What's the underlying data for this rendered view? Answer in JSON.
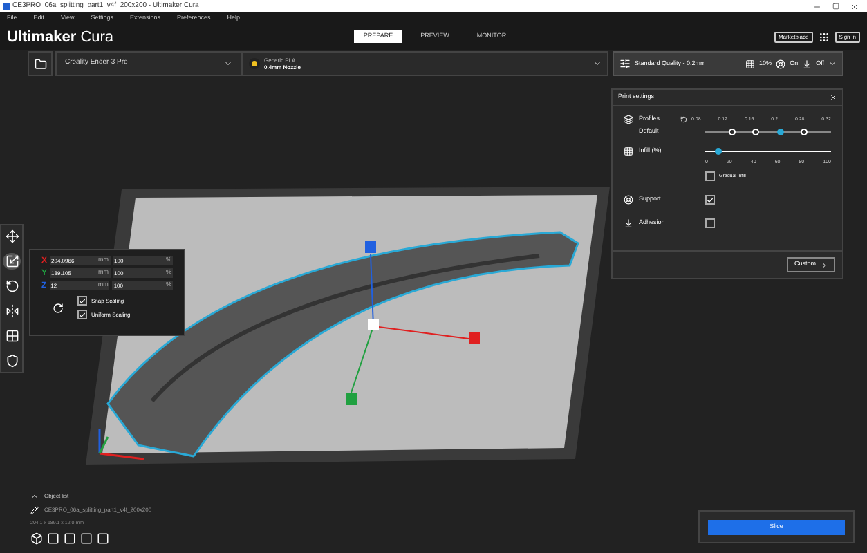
{
  "window": {
    "title": "CE3PRO_06a_splitting_part1_v4f_200x200 - Ultimaker Cura"
  },
  "menu": [
    "File",
    "Edit",
    "View",
    "Settings",
    "Extensions",
    "Preferences",
    "Help"
  ],
  "logo": {
    "brand": "Ultimaker",
    "product": "Cura"
  },
  "tabs": [
    {
      "label": "PREPARE",
      "selected": true
    },
    {
      "label": "PREVIEW",
      "selected": false
    },
    {
      "label": "MONITOR",
      "selected": false
    }
  ],
  "header_buttons": [
    "Marketplace",
    "Sign in"
  ],
  "printer": {
    "name": "Creality Ender-3 Pro"
  },
  "material": {
    "name": "Generic PLA",
    "nozzle": "0.4mm Nozzle"
  },
  "quality": {
    "profile": "Standard Quality - 0.2mm",
    "infill": "10%",
    "support": "On",
    "adhesion": "Off"
  },
  "print_settings": {
    "title": "Print settings",
    "profiles": {
      "label": "Profiles",
      "profile": "Default",
      "options": [
        {
          "label": "0.08",
          "available": false,
          "selected": false
        },
        {
          "label": "0.12",
          "available": true,
          "selected": false
        },
        {
          "label": "0.16",
          "available": true,
          "selected": false
        },
        {
          "label": "0.2",
          "available": true,
          "selected": true
        },
        {
          "label": "0.28",
          "available": true,
          "selected": false
        },
        {
          "label": "0.32",
          "available": false,
          "selected": false
        }
      ]
    },
    "infill": {
      "label": "Infill (%)",
      "level": 0.1,
      "ticks": [
        "0",
        "20",
        "40",
        "60",
        "80",
        "100"
      ],
      "gradual": {
        "label": "Gradual infill",
        "checked": false
      }
    },
    "support": {
      "label": "Support",
      "checked": true
    },
    "adhesion": {
      "label": "Adhesion",
      "checked": false
    },
    "custom_button": "Custom"
  },
  "tools": [
    {
      "kind": "move",
      "selected": false
    },
    {
      "kind": "scale",
      "selected": true
    },
    {
      "kind": "rotate",
      "selected": false
    },
    {
      "kind": "mirror",
      "selected": false
    },
    {
      "kind": "per_model",
      "selected": false
    },
    {
      "kind": "support_blocker",
      "selected": false
    }
  ],
  "scale": {
    "rows": [
      {
        "axis": "X",
        "color": "#e02020",
        "mm": "204.0966",
        "unit": "mm",
        "percent": "100",
        "percent_unit": "%"
      },
      {
        "axis": "Y",
        "color": "#20a040",
        "mm": "189.105",
        "unit": "mm",
        "percent": "100",
        "percent_unit": "%"
      },
      {
        "axis": "Z",
        "color": "#2060e0",
        "mm": "12",
        "unit": "mm",
        "percent": "100",
        "percent_unit": "%"
      }
    ],
    "snap": {
      "label": "Snap Scaling",
      "checked": true
    },
    "uniform": {
      "label": "Uniform Scaling",
      "checked": true
    }
  },
  "object_list": {
    "toggle": "Object list",
    "file": "CE3PRO_06a_splitting_part1_v4f_200x200",
    "dimensions": "204.1 x 189.1 x 12.0 mm"
  },
  "view_buttons": [
    {
      "kind": "perspective"
    },
    {
      "kind": "front"
    },
    {
      "kind": "top"
    },
    {
      "kind": "left"
    },
    {
      "kind": "right"
    }
  ],
  "slice_button": "Slice"
}
